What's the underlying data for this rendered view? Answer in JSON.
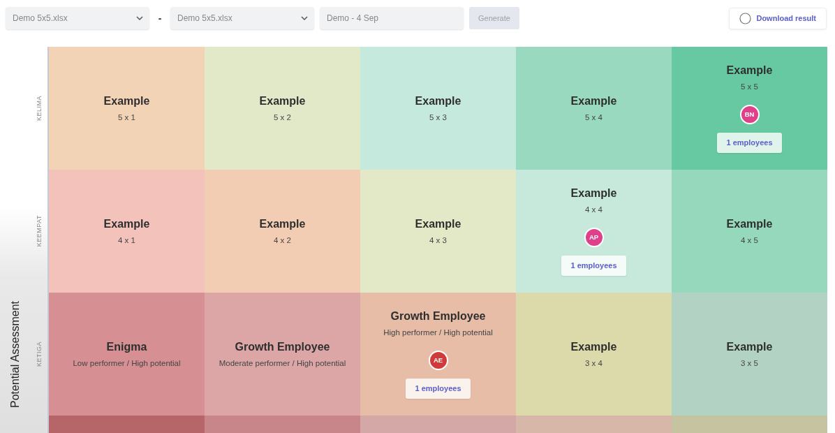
{
  "toolbar": {
    "source_a": {
      "value": "Demo 5x5.xlsx"
    },
    "separator": "-",
    "source_b": {
      "value": "Demo 5x5.xlsx"
    },
    "name_field": {
      "value": "Demo - 4 Sep"
    },
    "generate": {
      "label": "Generate",
      "disabled": true
    },
    "download": {
      "label": "Download result"
    }
  },
  "axis": {
    "title": "Potential Assessment"
  },
  "rows": [
    {
      "label": "KELIMA",
      "cells": [
        {
          "title": "Example",
          "subtitle": "5 x 1",
          "color": "#f3d3b6"
        },
        {
          "title": "Example",
          "subtitle": "5 x 2",
          "color": "#e2e9c8"
        },
        {
          "title": "Example",
          "subtitle": "5 x 3",
          "color": "#c5e9dc"
        },
        {
          "title": "Example",
          "subtitle": "5 x 4",
          "color": "#98d9bf"
        },
        {
          "title": "Example",
          "subtitle": "5 x 5",
          "color": "#66c9a2",
          "avatar": {
            "initials": "BN",
            "color": "#e0408a"
          },
          "count": "1 employees"
        }
      ]
    },
    {
      "label": "KEEMPAT",
      "cells": [
        {
          "title": "Example",
          "subtitle": "4 x 1",
          "color": "#f2c2bb"
        },
        {
          "title": "Example",
          "subtitle": "4 x 2",
          "color": "#f2cdb3"
        },
        {
          "title": "Example",
          "subtitle": "4 x 3",
          "color": "#e3e8c6"
        },
        {
          "title": "Example",
          "subtitle": "4 x 4",
          "color": "#c6e9dc",
          "avatar": {
            "initials": "AP",
            "color": "#e0408a"
          },
          "count": "1 employees"
        },
        {
          "title": "Example",
          "subtitle": "4 x 5",
          "color": "#95d8bc"
        }
      ]
    },
    {
      "label": "KETIGA",
      "cells": [
        {
          "title": "Enigma",
          "subtitle": "Low performer / High potential",
          "color": "#d68f92"
        },
        {
          "title": "Growth Employee",
          "subtitle": "Moderate performer / High potential",
          "color": "#dba6a5"
        },
        {
          "title": "Growth Employee",
          "subtitle": "High performer / High potential",
          "color": "#e7bda7",
          "avatar": {
            "initials": "AE",
            "color": "#d03a3a"
          },
          "count": "1 employees"
        },
        {
          "title": "Example",
          "subtitle": "3 x 4",
          "color": "#dcd9ab"
        },
        {
          "title": "Example",
          "subtitle": "3 x 5",
          "color": "#b2d3c3"
        }
      ]
    },
    {
      "cells": [
        {
          "color": "#b66669"
        },
        {
          "color": "#c9868a"
        },
        {
          "color": "#d3a8a6"
        },
        {
          "color": "#d7b8a8"
        },
        {
          "color": "#c6c4a0"
        }
      ]
    }
  ]
}
